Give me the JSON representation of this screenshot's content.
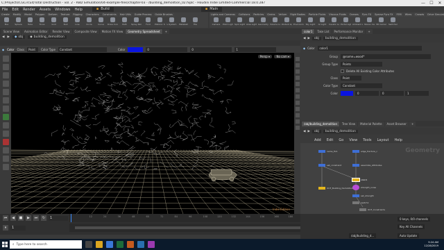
{
  "window": {
    "title": "C:/Projects/CGCircuit/Total Destruction - vol. 2 - RBD Simulation/04-example-files/chapter-03 - /building_demolition_02.hiplc - Houdini Indie Limited-Commercial 18.0.287",
    "minimize": "—",
    "maximize": "☐",
    "close": "✕"
  },
  "menubar": {
    "items": [
      "File",
      "Edit",
      "Render",
      "Assets",
      "Windows",
      "Help"
    ],
    "build_label": "Build",
    "main_label": "Main"
  },
  "shelf_left": {
    "tabs": [
      "Create",
      "Modify",
      "Model",
      "Polygon",
      "Deform",
      "Texture",
      "Rigging",
      "Characters",
      "Constraints",
      "Hair Utils",
      "Guide Process",
      "Guide Brushes"
    ],
    "tools": [
      "Box",
      "Sphere",
      "Tube",
      "Torus",
      "Grid",
      "Null",
      "Line",
      "Circle",
      "Curve",
      "Draw Curve",
      "Path",
      "Spray Paint",
      "Font",
      "Platonic Solids",
      "L-System",
      "Metaball",
      "File"
    ]
  },
  "shelf_right": {
    "tabs": [
      "Lights and Cameras",
      "Collisions",
      "Particles",
      "Grains",
      "Vellum",
      "Rigid Bodies",
      "Particle Fluids",
      "Viscous Fluids",
      "Oceans",
      "Pyro FX",
      "Sparse Pyro FX",
      "FEM",
      "Wires",
      "Crowds",
      "Drive Simulation"
    ],
    "tools": [
      "Camera",
      "Point Light",
      "Spot Light",
      "Area Light",
      "Geometry Light",
      "Volume Light",
      "Distant Light",
      "Environment Light",
      "Sky Light",
      "GI Light",
      "Caustic Light",
      "Portal Light",
      "Ambient Light",
      "Stereo Camera",
      "VR Camera",
      "Switcher"
    ]
  },
  "viewer_tabs": [
    "Scene View",
    "Animation Editor",
    "Render View",
    "Composite View",
    "Motion FX View",
    "Geometry Spreadsheet",
    "+"
  ],
  "viewer": {
    "obj": "obj",
    "node": "building_demolition",
    "persp": "Persp ▾",
    "nocam": "No cam ▾",
    "toolbar": {
      "node_name": "Color",
      "class_label": "Class",
      "class_value": "Point",
      "color_type_label": "Color Type",
      "color_type_value": "Constant",
      "color_label": "Color",
      "color_value": "0",
      "color_value2": "0",
      "color_value3": "1"
    },
    "watermark": "Indie Edition"
  },
  "param_panel": {
    "tabs": [
      "color1",
      "Take List",
      "Performance Monitor",
      "+"
    ],
    "obj": "obj",
    "node": "building_demolition",
    "node_type": "Color",
    "node_name": "color1",
    "rows": [
      {
        "label": "Group",
        "value": "@name=wood*"
      },
      {
        "label": "Group Type",
        "value": "Points"
      },
      {
        "label": "",
        "value": "Delete All Existing Color Attributes"
      },
      {
        "label": "Class",
        "value": "Point"
      },
      {
        "label": "Color Type",
        "value": "Constant"
      },
      {
        "label": "Color",
        "value": "0",
        "value2": "0",
        "value3": "1"
      }
    ]
  },
  "network_panel": {
    "tabs": [
      "/obj/building_demolition",
      "Tree View",
      "Material Palette",
      "Asset Browser",
      "+"
    ],
    "obj": "obj",
    "node": "building_demolition",
    "menu": [
      "Add",
      "Edit",
      "Go",
      "View",
      "Tools",
      "Layout",
      "Help"
    ],
    "context_label": "Geometry",
    "nodes": [
      {
        "label": "name_fix1"
      },
      {
        "label": "edge_fracture_c"
      },
      {
        "label": "set_constraint"
      },
      {
        "label": "assemble_attributes"
      },
      {
        "label": "color1"
      },
      {
        "label": "strength_noise"
      },
      {
        "label": "OUT_Building_Demolition"
      },
      {
        "label": "set_strength"
      },
      {
        "label": "switch1"
      },
      {
        "label": "OUT_Constraints"
      }
    ]
  },
  "timeline": {
    "frame": "1",
    "start": "1",
    "end": "240",
    "end2": "240",
    "ticks": [
      "12",
      "24",
      "36",
      "48",
      "60",
      "72",
      "84",
      "96",
      "108",
      "120",
      "132",
      "144",
      "156",
      "168",
      "180",
      "192",
      "204",
      "216",
      "228"
    ],
    "keys_info": "0 keys, 0/0 channels",
    "key_all": "Key All Channels",
    "auto_update": "Auto Update",
    "path_field": "/obj/building_d..."
  },
  "taskbar": {
    "search_placeholder": "Type here to search",
    "time": "9:24 AM",
    "date": "12/28/2019"
  },
  "colors": {
    "accent_blue": "#0a14e0",
    "node_yellow": "#e3b51d",
    "node_blue": "#3e6fd6",
    "node_purple": "#b84cd6",
    "taskbar": "#0b1a2b"
  }
}
